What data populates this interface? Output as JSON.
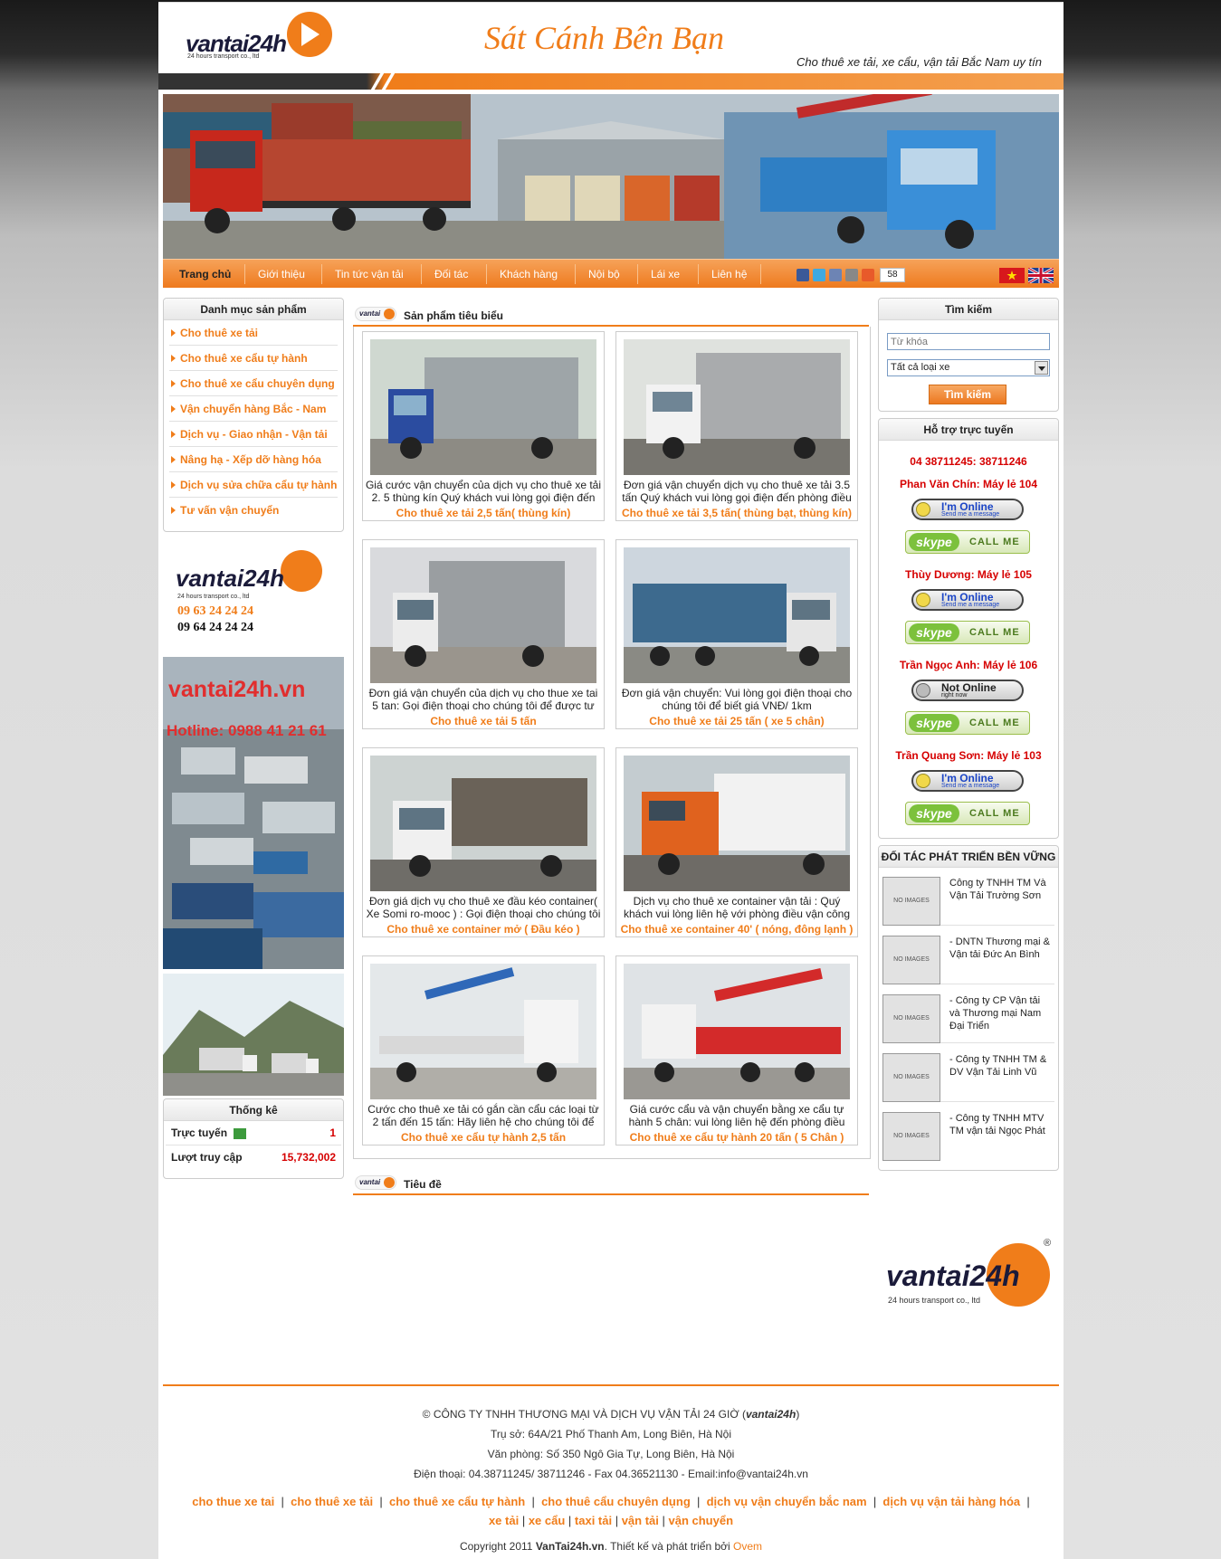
{
  "header": {
    "logo_text": "vantai24h",
    "logo_sub": "24 hours transport co., ltd",
    "slogan": "Sát Cánh Bên Bạn",
    "tagline": "Cho thuê xe tải, xe cẩu, vận tải Bắc Nam uy tín"
  },
  "nav": {
    "items": [
      "Trang chủ",
      "Giới thiệu",
      "Tin tức vận tải",
      "Đối tác",
      "Khách hàng",
      "Nội bộ",
      "Lái xe",
      "Liên hệ"
    ],
    "share_count": "58"
  },
  "left": {
    "category_title": "Danh mục sản phẩm",
    "categories": [
      "Cho thuê xe tải",
      "Cho thuê xe cẩu tự hành",
      "Cho thuê xe cẩu chuyên dụng",
      "Vận chuyển hàng Bắc - Nam",
      "Dịch vụ - Giao nhận - Vận tải",
      "Nâng hạ - Xếp dỡ hàng hóa",
      "Dịch vụ sửa chữa cẩu tự hành",
      "Tư vấn vận chuyển"
    ],
    "ad_logo": "vantai24h",
    "ad_logo_sub": "24 hours transport co., ltd",
    "ad_phone1": "09 63 24 24 24",
    "ad_phone2": "09 64 24 24 24",
    "banner_site": "vantai24h.vn",
    "banner_hotline": "Hotline: 0988 41 21 61",
    "stats_title": "Thống kê",
    "stats": [
      {
        "label": "Trực tuyến",
        "value": "1"
      },
      {
        "label": "Lượt truy cập",
        "value": "15,732,002"
      }
    ]
  },
  "center": {
    "featured_title": "Sản phẩm tiêu biểu",
    "section2_title": "Tiêu đề",
    "products": [
      {
        "desc": "Giá cước vận chuyển của dịch vụ cho thuê xe tải 2. 5 thùng kín Quý khách vui lòng gọi điện đến",
        "name": "Cho thuê xe tải 2,5 tấn( thùng kín)"
      },
      {
        "desc": "Đơn giá vận chuyển dịch vụ cho thuê xe tải 3.5 tấn Quý khách vui lòng gọi điện đến phòng điều",
        "name": "Cho thuê xe tải 3,5 tấn( thùng bạt, thùng kín)"
      },
      {
        "desc": "Đơn giá vận chuyển của dịch vụ cho thue xe tai 5 tan: Gọi điện thoại cho chúng tôi để được tư vấn",
        "name": "Cho thuê xe tải 5 tấn"
      },
      {
        "desc": "Đơn giá vận chuyển: Vui lòng gọi điện thoại cho chúng tôi để biết giá VNĐ/ 1km",
        "name": "Cho thuê xe tải 25 tấn ( xe 5 chân)"
      },
      {
        "desc": "Đơn giá dịch vụ cho thuê xe đầu kéo container( Xe Somi ro-mooc ) : Gọi điện thoại cho chúng tôi",
        "name": "Cho thuê xe container mở ( Đầu kéo )"
      },
      {
        "desc": "Dịch vụ cho thuê xe container vận tải : Quý khách vui lòng liên hệ với phòng điều vận công ty chúng",
        "name": "Cho thuê xe container 40' ( nóng, đông lạnh )"
      },
      {
        "desc": "Cước cho thuê xe tải có gắn cần cẩu các loại từ 2 tấn đến 15 tấn: Hãy liên hệ cho chúng tôi để",
        "name": "Cho thuê xe cẩu tự hành 2,5 tấn"
      },
      {
        "desc": "Giá cước cẩu và vận chuyển bằng xe cẩu tự hành 5 chân: vui lòng liên hệ đến phòng điều hành vận",
        "name": "Cho thuê xe cẩu tự hành 20 tấn ( 5 Chân )"
      }
    ]
  },
  "right": {
    "search_title": "Tìm kiếm",
    "search_placeholder": "Từ khóa",
    "search_select": "Tất cả loại xe",
    "search_button": "Tìm kiếm",
    "support_title": "Hỗ trợ trực tuyến",
    "support_phone": "04 38711245: 38711246",
    "supporters": [
      {
        "name": "Phan Văn Chín: Máy lẻ 104",
        "status": "I'm Online",
        "status_sub": "Send me a message"
      },
      {
        "name": "Thùy Dương: Máy lẻ 105",
        "status": "I'm Online",
        "status_sub": "Send me a message"
      },
      {
        "name": "Trần Ngọc Anh: Máy lẻ 106",
        "status": "Not Online",
        "status_sub": "right now"
      },
      {
        "name": "Trần Quang Sơn: Máy lẻ 103",
        "status": "I'm Online",
        "status_sub": "Send me a message"
      }
    ],
    "skype_label": "skype",
    "skype_call": "CALL ME",
    "partners_title": "ĐỐI TÁC PHÁT TRIỂN BỀN VỮNG",
    "no_image": "NO IMAGES",
    "partners": [
      "Công ty TNHH TM Và Vận Tải Trường Sơn",
      "- DNTN Thương mại & Vận tải Đức An Bình",
      "- Công ty CP Vận tải và Thương mại Nam Đại Triển",
      "- Công ty TNHH TM & DV Vận Tải Linh Vũ",
      "- Công ty TNHH MTV TM vận tải Ngọc Phát"
    ],
    "footer_logo": "vantai24h",
    "footer_logo_sub": "24 hours transport co., ltd"
  },
  "footer": {
    "company_prefix": "© CÔNG TY TNHH THƯƠNG MẠI VÀ DỊCH VỤ VẬN TẢI 24 GIỜ (",
    "company_brand": "vantai24h",
    "company_suffix": ")",
    "address": "Trụ sở: 64A/21 Phố Thanh Am, Long Biên, Hà Nội",
    "office": "Văn phòng: Số 350 Ngô Gia Tự, Long Biên, Hà Nội",
    "phone": "Điện thoại: 04.38711245/ 38711246 - Fax 04.36521130 -  Email:info@vantai24h.vn",
    "links_row1": [
      "cho thue xe tai",
      "cho thuê xe tải",
      "cho thuê xe cẩu tự hành",
      "cho thuê cẩu chuyên dụng",
      "dịch vụ vận chuyển bắc nam",
      "dịch vụ vận tải hàng hóa"
    ],
    "links_row2": [
      "xe tải",
      "xe cẩu",
      "taxi tải",
      "vận tải",
      "vận chuyển"
    ],
    "copyright_prefix": "Copyright 2011 ",
    "copyright_site": "VanTai24h.vn",
    "copyright_mid": ". Thiết kế và phát triển bởi ",
    "copyright_dev": "Ovem"
  },
  "colors": {
    "accent": "#f07d1a",
    "alert": "#d60000"
  }
}
